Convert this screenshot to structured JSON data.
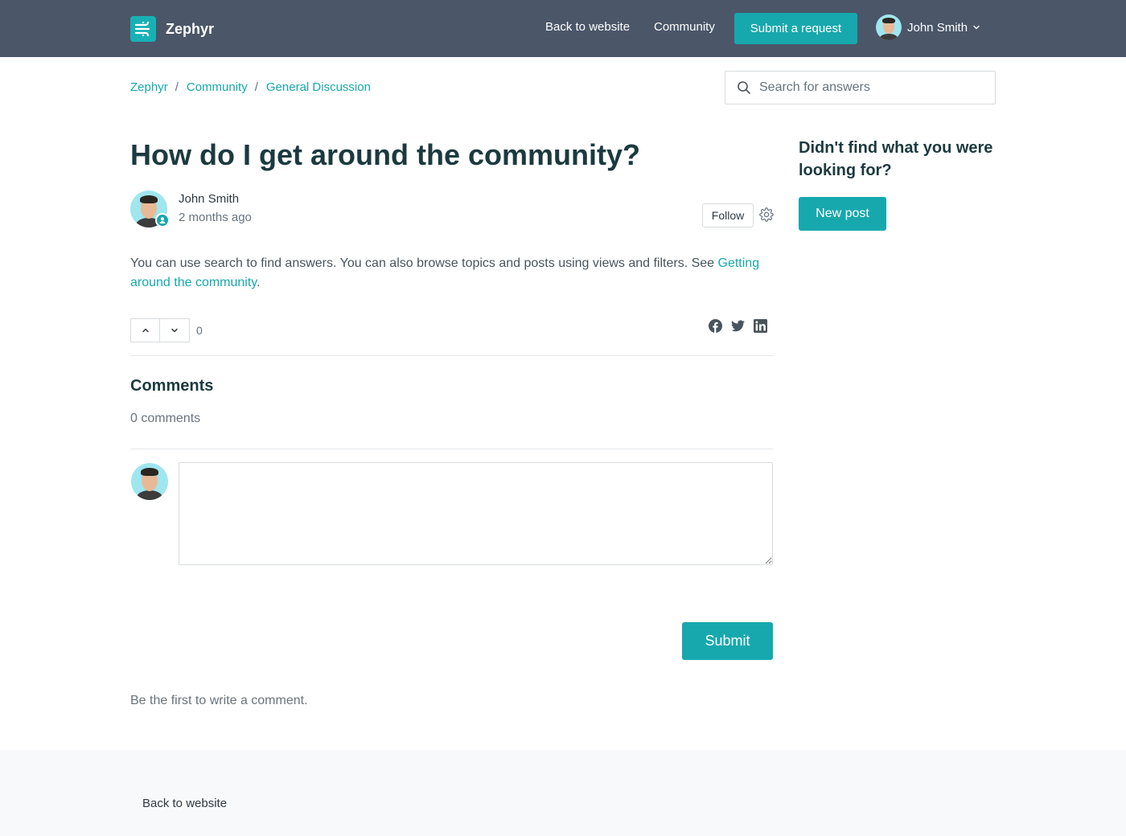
{
  "header": {
    "brand": "Zephyr",
    "nav": {
      "back_to_website": "Back to website",
      "community": "Community",
      "submit_request": "Submit a request"
    },
    "user": {
      "name": "John Smith"
    }
  },
  "breadcrumb": [
    "Zephyr",
    "Community",
    "General Discussion"
  ],
  "search": {
    "placeholder": "Search for answers"
  },
  "post": {
    "title": "How do I get around the community?",
    "author": "John Smith",
    "time": "2 months ago",
    "follow_label": "Follow",
    "body_text": "You can use search to find answers. You can also browse topics and posts using views and filters. See ",
    "body_link": "Getting around the community",
    "body_end": ".",
    "vote_count": "0"
  },
  "comments": {
    "title": "Comments",
    "count_text": "0 comments",
    "submit_label": "Submit",
    "empty_text": "Be the first to write a comment."
  },
  "sidebar": {
    "title": "Didn't find what you were looking for?",
    "new_post_label": "New post"
  },
  "footer": {
    "back_to_website": "Back to website"
  },
  "colors": {
    "accent": "#17a8ad",
    "header": "#4b5669",
    "heading": "#1b3a3f"
  }
}
